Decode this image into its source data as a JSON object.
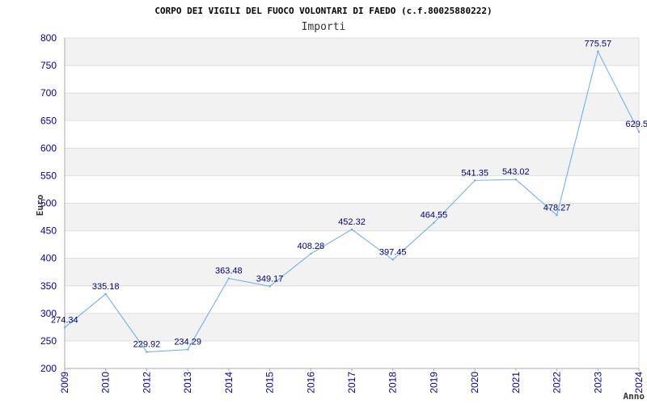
{
  "chart_data": {
    "type": "line",
    "title": "CORPO DEI VIGILI DEL FUOCO VOLONTARI DI FAEDO (c.f.80025880222)",
    "subtitle": "Importi",
    "xlabel": "Anno",
    "ylabel": "Euro",
    "ylim": [
      200,
      800
    ],
    "yticks": [
      200,
      250,
      300,
      350,
      400,
      450,
      500,
      550,
      600,
      650,
      700,
      750,
      800
    ],
    "grid": true,
    "categories": [
      "2009",
      "2010",
      "2012",
      "2013",
      "2014",
      "2015",
      "2016",
      "2017",
      "2018",
      "2019",
      "2020",
      "2021",
      "2022",
      "2023",
      "2024"
    ],
    "series": [
      {
        "values": [
          274.34,
          335.18,
          229.92,
          234.29,
          363.48,
          349.17,
          408.28,
          452.32,
          397.45,
          464.55,
          541.35,
          543.02,
          478.27,
          775.57,
          629.5
        ],
        "labels": [
          "274.34",
          "335.18",
          "229.92",
          "234.29",
          "363.48",
          "349.17",
          "408.28",
          "452.32",
          "397.45",
          "464.55",
          "541.35",
          "543.02",
          "478.27",
          "775.57",
          "629.5"
        ],
        "color": "#66aaee"
      }
    ],
    "colors": {
      "band": "#f2f2f2",
      "gridline": "#dddddd",
      "axis": "#aaaaaa",
      "tick_text": "#0000aa",
      "data_label": "#000080"
    }
  }
}
